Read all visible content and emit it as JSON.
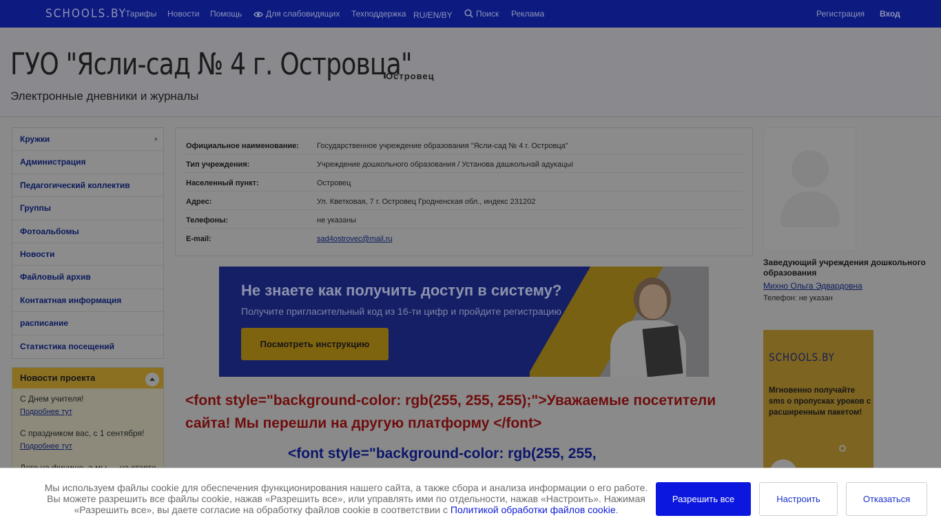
{
  "topnav": {
    "logo": "SCHOOLS.BY",
    "items": [
      "Тарифы",
      "Новости",
      "Помощь",
      "Для слабовидящих",
      "Техподдержка",
      "RU/EN/BY",
      "Поиск",
      "Реклама"
    ],
    "register": "Регистрация",
    "login": "Вход"
  },
  "header": {
    "title": "ГУО \"Ясли-сад № 4 г. Островца\"",
    "city": "Островец",
    "subtitle": "Электронные дневники и журналы"
  },
  "sidebar": {
    "items": [
      "Кружки",
      "Администрация",
      "Педагогический коллектив",
      "Группы",
      "Фотоальбомы",
      "Новости",
      "Файловый архив",
      "Контактная информация",
      "расписание",
      "Статистика посещений"
    ],
    "news_title": "Новости проекта",
    "news": [
      {
        "text": "С Днем учителя!",
        "link": "Подробнее тут"
      },
      {
        "text": "С праздником вас, с 1 сентября!",
        "link": "Подробнее тут"
      },
      {
        "text": "Лето на финише, а мы — на старте",
        "link": ""
      }
    ]
  },
  "info": {
    "rows": [
      {
        "label": "Официальное наименование:",
        "value": "Государственное учреждение образования \"Ясли-сад № 4 г. Островца\""
      },
      {
        "label": "Тип учреждения:",
        "value": "Учреждение дошкольного образования / Установа дашкольнай адукацыі"
      },
      {
        "label": "Населенный пункт:",
        "value": "Островец"
      },
      {
        "label": "Адрес:",
        "value": "Ул. Кветковая, 7 г. Островец Гродненская обл., индекс 231202"
      },
      {
        "label": "Телефоны:",
        "value": "не указаны"
      },
      {
        "label": "E-mail:",
        "value": "sad4ostrovec@mail.ru"
      }
    ]
  },
  "banner": {
    "heading": "Не знаете как получить доступ в систему?",
    "text": "Получите пригласительный код из 16-ти цифр и пройдите регистрацию",
    "button": "Посмотреть инструкцию"
  },
  "content": {
    "red_text": "<font style=\"background-color: rgb(255, 255, 255);\">Уважаемые посетители сайта! Мы перешли на другую платформу  </font>",
    "blue_text": "<font style=\"background-color: rgb(255, 255,"
  },
  "head": {
    "role": "Заведующий учреждения дошкольного образования",
    "name": "Михно Ольга Эдвардовна",
    "phone": "Телефон: не указан"
  },
  "promo": {
    "logo": "SCHOOLS.BY",
    "text": "Мгновенно получайте sms о пропусках уроков с расширенным пакетом!"
  },
  "cookie": {
    "text": "Мы используем файлы cookie для обеспечения функционирования нашего сайта, а также сбора и анализа информации о его работе. Вы можете разрешить все файлы cookie, нажав «Разрешить все», или управлять ими по отдельности, нажав «Настроить». Нажимая «Разрешить все», вы даете согласие на обработку файлов cookie в соответствии с",
    "link": "Политикой обработки файлов cookie",
    "allow": "Разрешить все",
    "configure": "Настроить",
    "decline": "Отказаться"
  }
}
